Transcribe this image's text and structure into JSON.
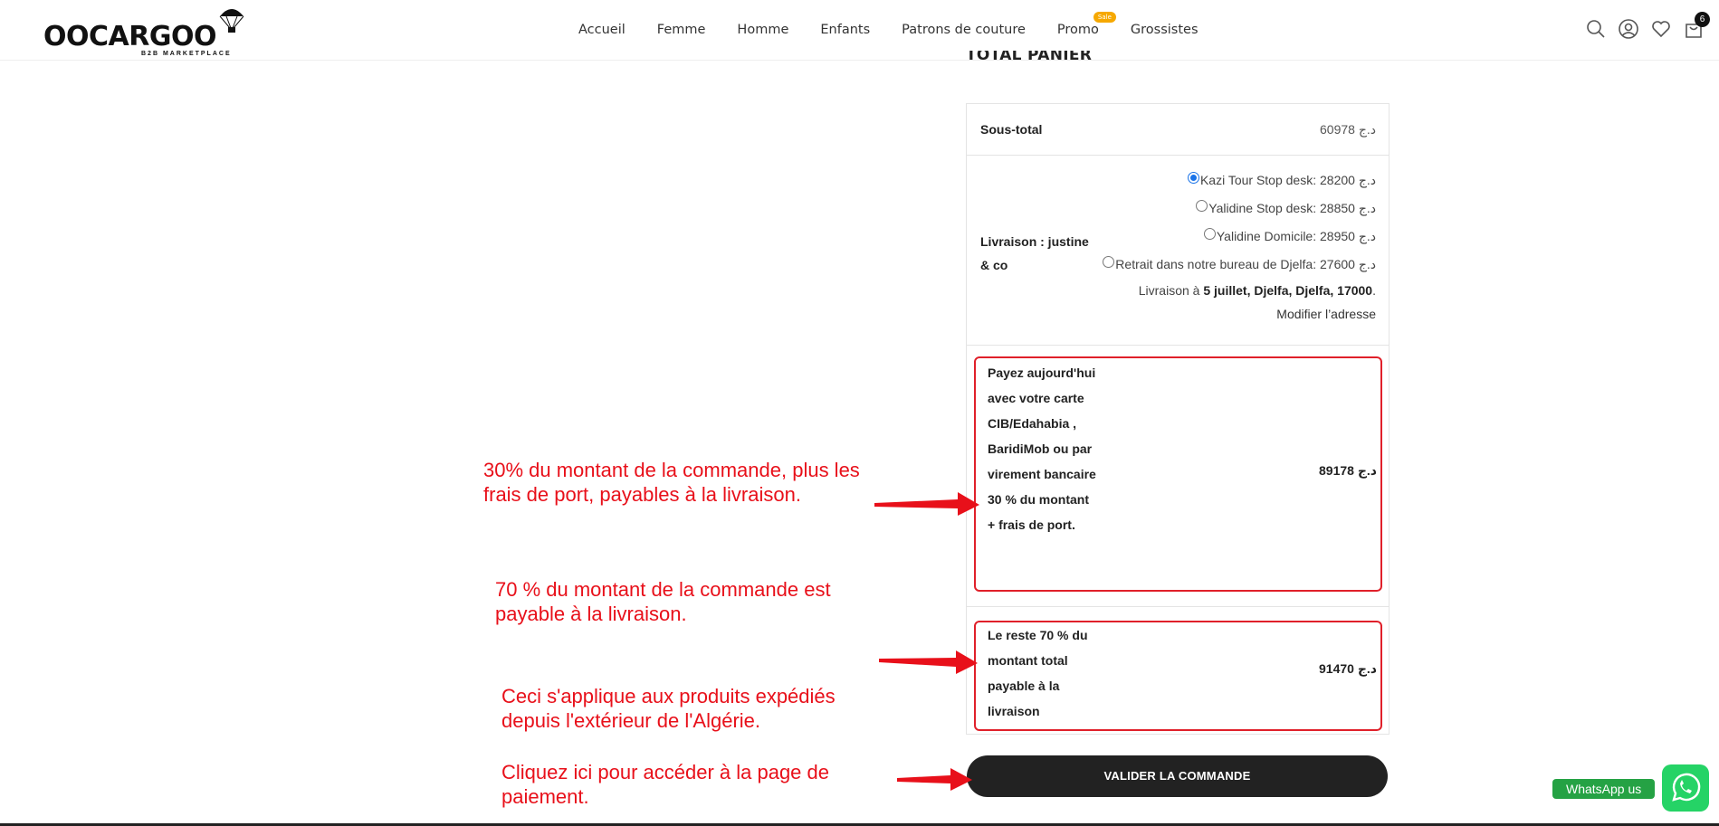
{
  "brand": {
    "name": "OOCARGOO",
    "tagline": "B2B MARKETPLACE"
  },
  "nav": {
    "items": [
      {
        "label": "Accueil"
      },
      {
        "label": "Femme"
      },
      {
        "label": "Homme"
      },
      {
        "label": "Enfants"
      },
      {
        "label": "Patrons de couture"
      },
      {
        "label": "Promo",
        "badge": "Sale"
      },
      {
        "label": "Grossistes"
      }
    ]
  },
  "header_icons": {
    "search": "search-icon",
    "account": "user-icon",
    "wishlist": "heart-icon",
    "cart": "shopping-bag-icon",
    "cart_count": "6"
  },
  "cart_totals": {
    "title": "TOTAL PANIER",
    "subtotal": {
      "label": "Sous-total",
      "value": "60978 د.ج"
    },
    "shipping": {
      "label": "Livraison : justine & co",
      "options": [
        {
          "label": "Kazi Tour Stop desk: د.ج 28200",
          "selected": true
        },
        {
          "label": "Yalidine Stop desk: د.ج 28850",
          "selected": false
        },
        {
          "label": "Yalidine Domicile: د.ج 28950",
          "selected": false
        },
        {
          "label": "Retrait dans notre bureau de Djelfa: د.ج 27600",
          "selected": false
        }
      ],
      "destination_prefix": "Livraison à ",
      "destination": "5 juillet, Djelfa, Djelfa, 17000",
      "destination_suffix": ".",
      "change_address": "Modifier l’adresse"
    },
    "pay_now": {
      "label": "Payez aujourd'hui avec votre carte CIB/Edahabia , BaridiMob ou par virement bancaire 30 % du montant + frais de port.",
      "value": "89178 د.ج"
    },
    "rest": {
      "label": "Le reste 70 % du montant total payable à la livraison",
      "value": "91470 د.ج"
    },
    "checkout_button": "VALIDER LA COMMANDE"
  },
  "annotations": {
    "note1_line1": "30% du montant de la commande, plus les",
    "note1_line2": "frais de port, payables à la livraison.",
    "note2_line1": "70 % du montant de la commande est",
    "note2_line2": "payable à la livraison.",
    "note3_line1": "Ceci s'applique aux produits expédiés",
    "note3_line2": "depuis l'extérieur de l'Algérie.",
    "note4_line1": "Cliquez ici pour accéder à la page de",
    "note4_line2": "paiement.",
    "color": "#e8101a"
  },
  "whatsapp": {
    "label": "WhatsApp us",
    "icon": "whatsapp-icon",
    "color": "#25d366"
  }
}
